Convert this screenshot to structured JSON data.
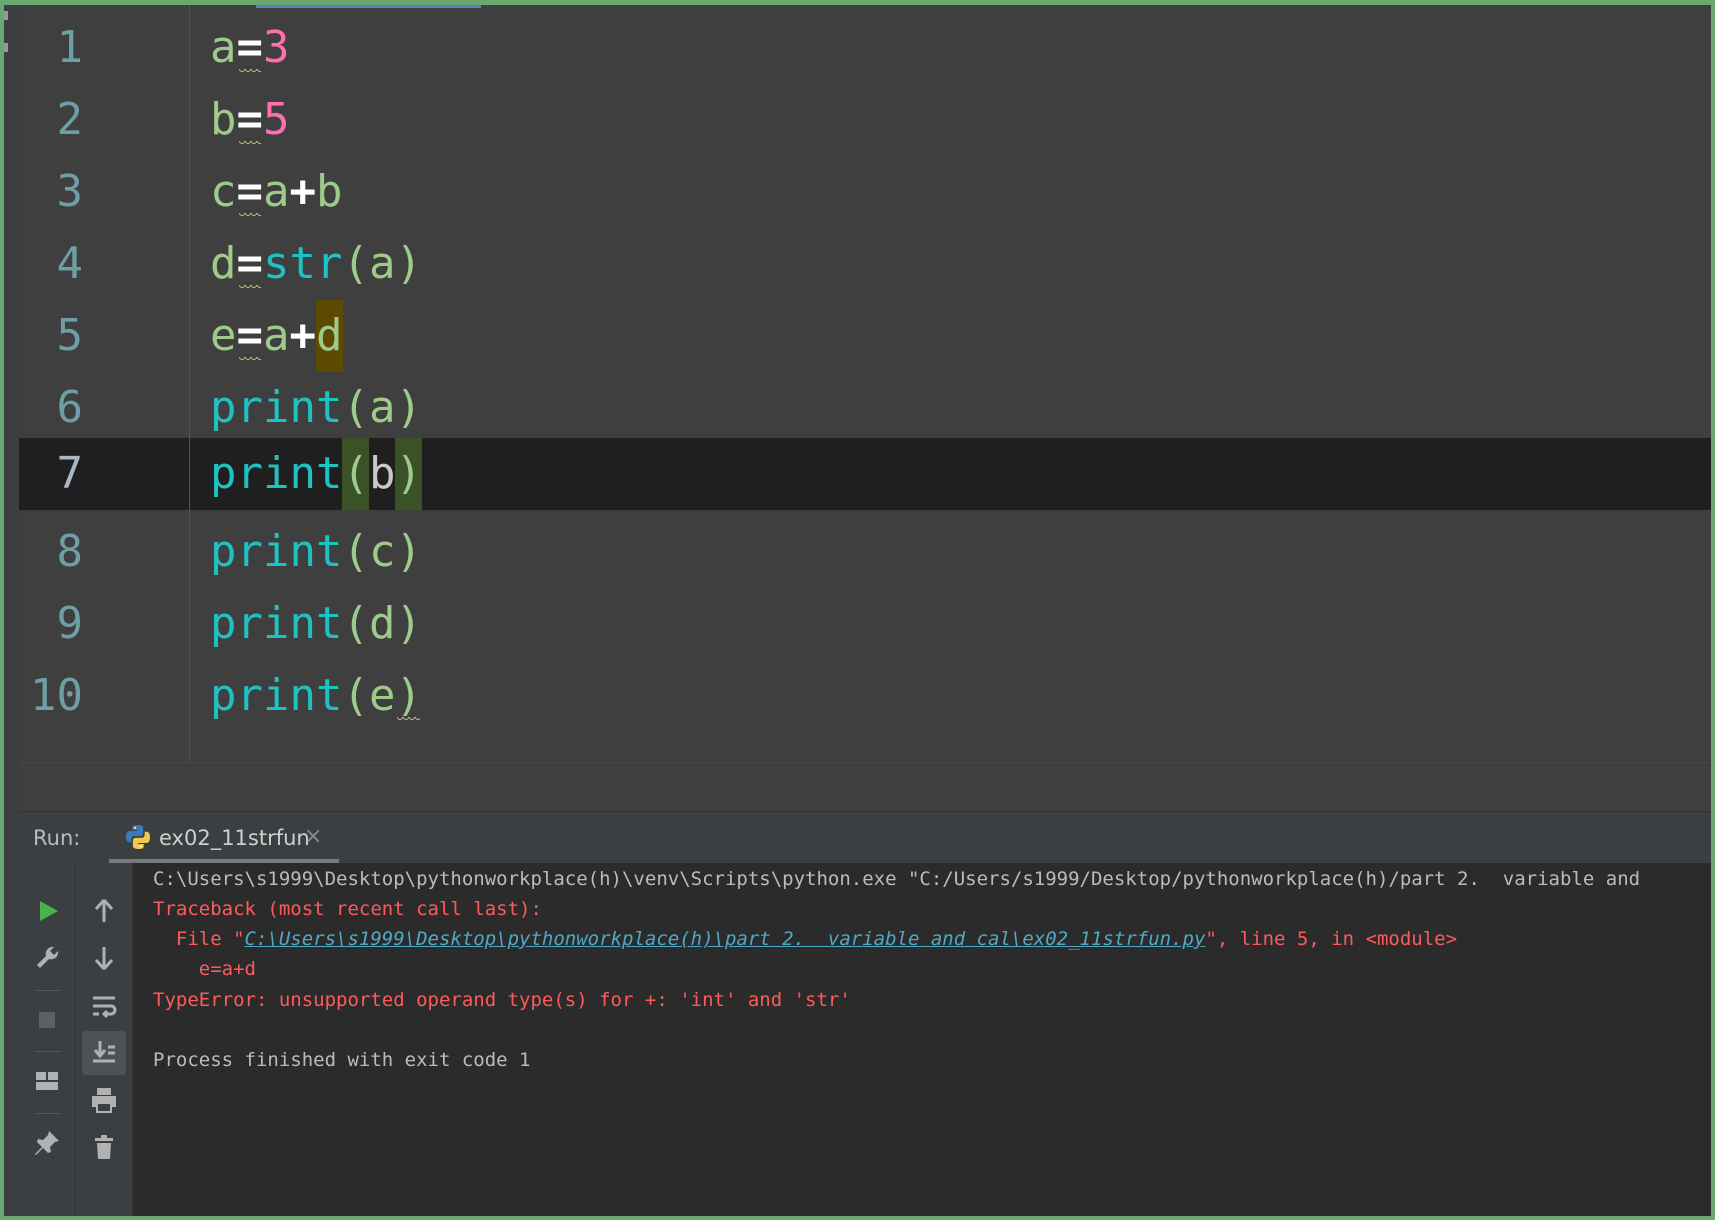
{
  "editor": {
    "line_numbers": [
      "1",
      "2",
      "3",
      "4",
      "5",
      "6",
      "7",
      "8",
      "9",
      "10"
    ],
    "current_line": "7",
    "lines": [
      {
        "var": "a",
        "eq": "=",
        "val": "3"
      },
      {
        "var": "b",
        "eq": "=",
        "val": "5"
      },
      {
        "var": "c",
        "eq": "=",
        "lhs": "a",
        "op": "+",
        "rhs": "b"
      },
      {
        "var": "d",
        "eq": "=",
        "fn": "str",
        "open": "(",
        "arg": "a",
        "close": ")"
      },
      {
        "var": "e",
        "eq": "=",
        "lhs": "a",
        "op": "+",
        "rhs": "d"
      },
      {
        "fn": "print",
        "open": "(",
        "arg": "a",
        "close": ")"
      },
      {
        "fn": "print",
        "open": "(",
        "arg": "b",
        "close": ")"
      },
      {
        "fn": "print",
        "open": "(",
        "arg": "c",
        "close": ")"
      },
      {
        "fn": "print",
        "open": "(",
        "arg": "d",
        "close": ")"
      },
      {
        "fn": "print",
        "open": "(",
        "arg": "e",
        "close": ")"
      }
    ]
  },
  "run_panel": {
    "label": "Run:",
    "tab_title": "ex02_11strfun",
    "tab_close": "×",
    "tab_icon": "python-icon",
    "toolbar_left": [
      "run-icon",
      "wrench-icon",
      "stop-icon",
      "layout-icon",
      "pin-icon"
    ],
    "toolbar_right": [
      "arrow-up-icon",
      "arrow-down-icon",
      "soft-wrap-icon",
      "scroll-to-end-icon",
      "print-icon",
      "trash-icon"
    ]
  },
  "console": {
    "command": "C:\\Users\\s1999\\Desktop\\pythonworkplace(h)\\venv\\Scripts\\python.exe \"C:/Users/s1999/Desktop/pythonworkplace(h)/part 2.  variable and",
    "traceback_header": "Traceback (most recent call last):",
    "file_prefix": "  File \"",
    "file_path": "C:\\Users\\s1999\\Desktop\\pythonworkplace(h)\\part 2.  variable and cal\\ex02_11strfun.py",
    "file_suffix": "\", line 5, in <module>",
    "code_line": "    e=a+d",
    "error": "TypeError: unsupported operand type(s) for +: 'int' and 'str'",
    "exit_message": "Process finished with exit code 1"
  },
  "colors": {
    "variable": "#9ecb8a",
    "number": "#ff6fae",
    "builtin": "#1fc2c2",
    "error_text": "#ff5a5a",
    "run_green": "#49b34d"
  }
}
